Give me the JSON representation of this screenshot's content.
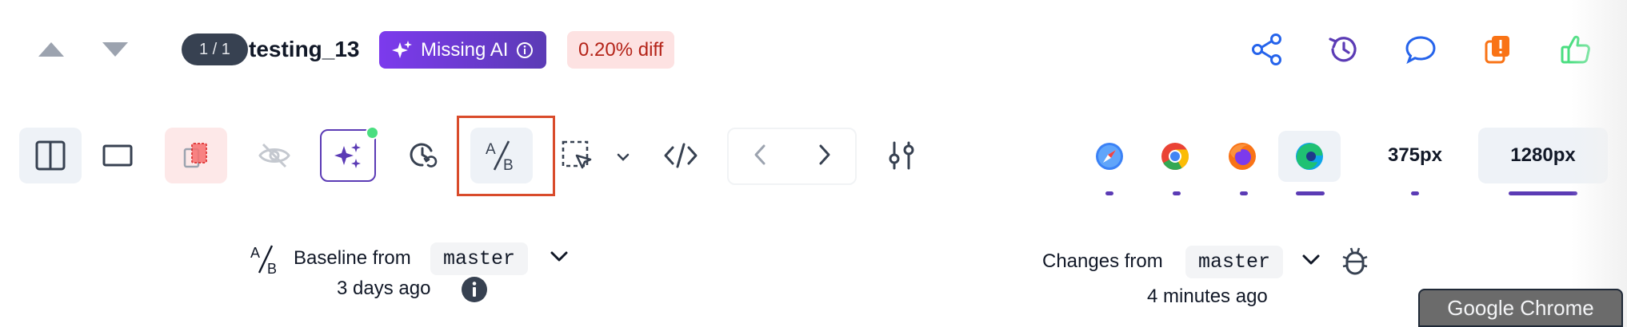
{
  "header": {
    "counter": "1 / 1",
    "title": "testing_13",
    "ai_badge": "Missing AI",
    "diff_badge": "0.20% diff"
  },
  "top_actions": [
    "share-icon",
    "history-icon",
    "comment-icon",
    "report-icon",
    "approve-icon"
  ],
  "toolbar": {
    "tools": [
      "split-view-icon",
      "single-view-icon",
      "overlay-icon",
      "hide-icon",
      "ai-sparkle-icon",
      "timer-icon",
      "ab-compare-icon",
      "region-select-icon",
      "code-icon",
      "prev-icon",
      "next-icon",
      "settings-icon"
    ]
  },
  "browsers": [
    "safari",
    "chrome",
    "firefox",
    "edge"
  ],
  "widths": [
    "375px",
    "1280px"
  ],
  "baseline": {
    "label": "Baseline from",
    "branch": "master",
    "time": "3 days ago"
  },
  "changes": {
    "label": "Changes from",
    "branch": "master",
    "time": "4 minutes ago"
  },
  "tooltip": "Google Chrome",
  "colors": {
    "accent": "#5b3bb5",
    "diff_bg": "#fde2e2",
    "diff_text": "#b42318",
    "focus_red": "#d94b2b",
    "approve_green": "#4ade80",
    "report_orange": "#f97316",
    "icon_blue": "#2563eb"
  }
}
